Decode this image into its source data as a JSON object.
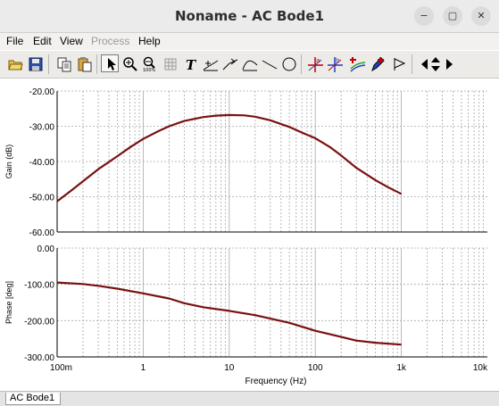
{
  "window": {
    "title": "Noname - AC Bode1",
    "minimize_symbol": "−",
    "maximize_symbol": "▢",
    "close_symbol": "✕"
  },
  "menu": [
    {
      "label": "File",
      "enabled": true
    },
    {
      "label": "Edit",
      "enabled": true
    },
    {
      "label": "View",
      "enabled": true
    },
    {
      "label": "Process",
      "enabled": false
    },
    {
      "label": "Help",
      "enabled": true
    }
  ],
  "toolbar_icons": [
    "open-folder-icon",
    "save-disk-icon",
    "copy-icon",
    "paste-icon",
    "pointer-icon",
    "zoom-in-icon",
    "zoom-100-icon",
    "grid-icon",
    "text-tool-icon",
    "line-marker-icon",
    "slope-marker-icon",
    "curve-marker-icon",
    "straight-line-icon",
    "ellipse-icon",
    "cursor-a-icon",
    "cursor-b-icon",
    "add-curve-icon",
    "pen-icon",
    "flag-icon",
    "arrow-left-icon",
    "arrow-up-down-icon",
    "arrow-right-icon"
  ],
  "tabs": [
    {
      "label": "AC Bode1"
    }
  ],
  "colors": {
    "curve": "#7a1010",
    "grid": "#a8a8a8",
    "background": "#ffffff"
  },
  "chart_data": [
    {
      "type": "line",
      "title": "",
      "xlabel": "Frequency (Hz)",
      "ylabel": "Gain (dB)",
      "xscale": "log",
      "xlim": [
        0.1,
        10000
      ],
      "ylim": [
        -60,
        -20
      ],
      "ytick_labels": [
        "-20.00",
        "-30.00",
        "-40.00",
        "-50.00",
        "-60.00"
      ],
      "yticks": [
        -20,
        -30,
        -40,
        -50,
        -60
      ],
      "grid": true,
      "series": [
        {
          "x": [
            0.1,
            0.15,
            0.2,
            0.3,
            0.5,
            0.7,
            1,
            1.5,
            2,
            3,
            5,
            7,
            10,
            15,
            20,
            30,
            50,
            70,
            100,
            150,
            200,
            300,
            500,
            700,
            1000
          ],
          "y": [
            -51.3,
            -48,
            -45.6,
            -42.2,
            -38.5,
            -36,
            -33.6,
            -31.4,
            -30,
            -28.5,
            -27.4,
            -27,
            -26.8,
            -26.9,
            -27.3,
            -28.3,
            -30.2,
            -31.8,
            -33.4,
            -36,
            -38.3,
            -41.8,
            -45.3,
            -47.3,
            -49.2
          ]
        }
      ]
    },
    {
      "type": "line",
      "title": "",
      "xlabel": "Frequency (Hz)",
      "ylabel": "Phase [deg]",
      "xscale": "log",
      "xlim": [
        0.1,
        10000
      ],
      "ylim": [
        -300,
        0
      ],
      "ytick_labels": [
        "0.00",
        "-100.00",
        "-200.00",
        "-300.00"
      ],
      "yticks": [
        0,
        -100,
        -200,
        -300
      ],
      "xticks": [
        0.1,
        1,
        10,
        100,
        1000,
        10000
      ],
      "xtick_labels": [
        "100m",
        "1",
        "10",
        "100",
        "1k",
        "10k"
      ],
      "grid": true,
      "series": [
        {
          "x": [
            0.1,
            0.2,
            0.3,
            0.5,
            1,
            2,
            3,
            5,
            10,
            20,
            50,
            100,
            200,
            300,
            500,
            1000
          ],
          "y": [
            -95,
            -99,
            -104,
            -112,
            -125,
            -139,
            -152,
            -163,
            -173,
            -185,
            -206,
            -228,
            -245,
            -255,
            -261,
            -266
          ]
        }
      ]
    }
  ]
}
